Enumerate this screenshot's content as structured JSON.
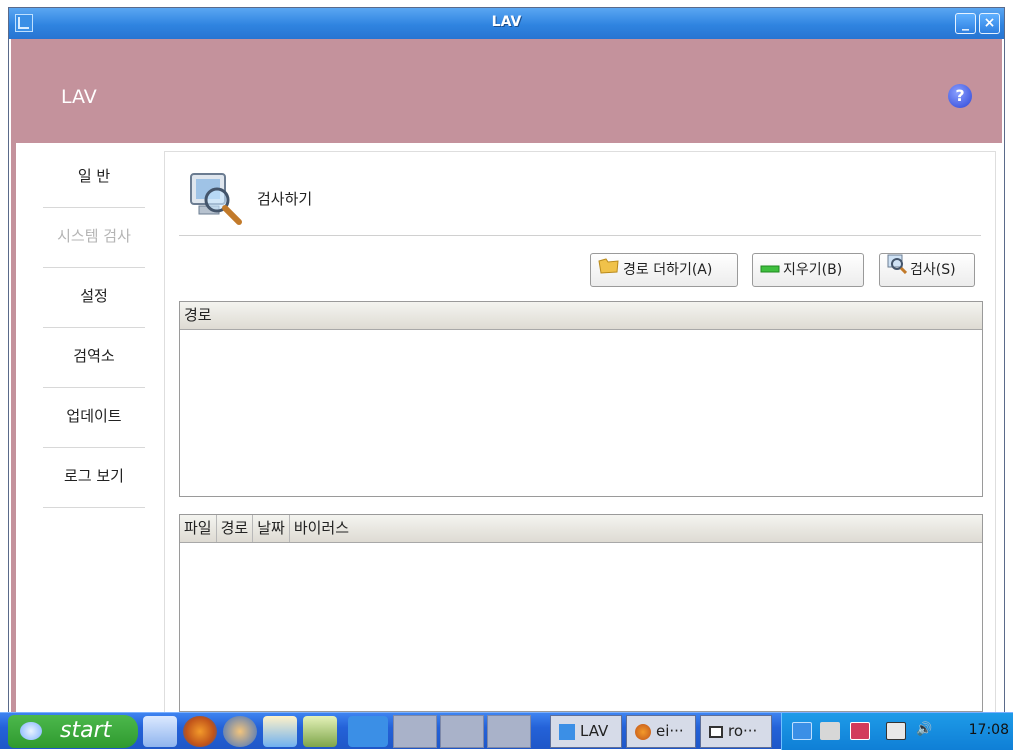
{
  "window": {
    "title": "LAV",
    "minimize_label": "_",
    "close_label": "×"
  },
  "header": {
    "app_name": "LAV",
    "help_label": "?"
  },
  "sidebar": {
    "items": [
      {
        "label": "일 반",
        "enabled": true
      },
      {
        "label": "시스템 검사",
        "enabled": false
      },
      {
        "label": "설정",
        "enabled": true
      },
      {
        "label": "검역소",
        "enabled": true
      },
      {
        "label": "업데이트",
        "enabled": true
      },
      {
        "label": "로그 보기",
        "enabled": true
      }
    ]
  },
  "main": {
    "section_title": "검사하기",
    "buttons": {
      "add_path": "경로 더하기(A)",
      "clear": "지우기(B)",
      "scan": "검사(S)"
    },
    "path_table": {
      "columns": [
        "경로"
      ],
      "rows": []
    },
    "result_table": {
      "columns": [
        "파일",
        "경로",
        "날짜",
        "바이러스"
      ],
      "rows": []
    }
  },
  "taskbar": {
    "start_label": "start",
    "tasks": [
      {
        "label": "LAV",
        "icon": "lav-icon"
      },
      {
        "label": "ei···",
        "icon": "firefox-icon"
      },
      {
        "label": "ro···",
        "icon": "window-icon"
      }
    ],
    "clock": "17:08"
  },
  "colors": {
    "accent": "#c4929c",
    "titlebar": "#2f84e0",
    "taskbar": "#2462d8"
  }
}
